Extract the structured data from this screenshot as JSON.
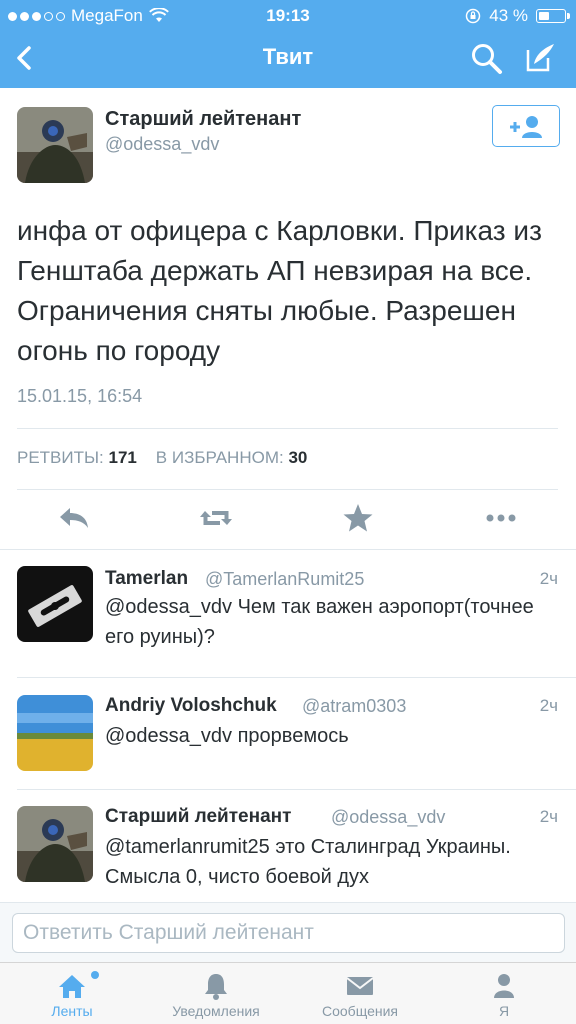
{
  "status_bar": {
    "carrier": "MegaFon",
    "time": "19:13",
    "battery": "43 %",
    "battery_level": 0.43
  },
  "nav": {
    "title": "Твит",
    "back_icon": "chevron-left-icon",
    "search_icon": "search-icon",
    "compose_icon": "compose-icon"
  },
  "tweet": {
    "author_name": "Старший лейтенант",
    "author_handle": "@odessa_vdv",
    "follow_icon": "add-user-icon",
    "text": "инфа от офицера с Карловки. Приказ из Генштаба держать АП невзирая на все. Ограничения сняты любые. Разрешен огонь по городу",
    "date": "15.01.15, 16:54",
    "retweets_label": "РЕТВИТЫ:",
    "retweets_count": "171",
    "favorites_label": "В ИЗБРАННОМ:",
    "favorites_count": "30",
    "actions": [
      "reply-icon",
      "retweet-icon",
      "star-icon",
      "more-icon"
    ]
  },
  "replies": [
    {
      "name": "Tamerlan",
      "handle": "@TamerlanRumit25",
      "time": "2ч",
      "text": "@odessa_vdv Чем так важен аэропорт(точнее его руины)?"
    },
    {
      "name": "Andriy Voloshchuk",
      "handle": "@atram0303",
      "time": "2ч",
      "text": "@odessa_vdv прорвемось"
    },
    {
      "name": "Старший лейтенант",
      "handle": "@odessa_vdv",
      "time": "2ч",
      "text": "@tamerlanrumit25 это Сталинград Украины. Смысла 0, чисто боевой дух"
    }
  ],
  "reply_box": {
    "placeholder": "Ответить Старший лейтенант"
  },
  "tabbar": {
    "tabs": [
      {
        "label": "Ленты",
        "icon": "home-icon",
        "active": true
      },
      {
        "label": "Уведомления",
        "icon": "bell-icon",
        "active": false
      },
      {
        "label": "Сообщения",
        "icon": "envelope-icon",
        "active": false
      },
      {
        "label": "Я",
        "icon": "person-icon",
        "active": false
      }
    ]
  },
  "colors": {
    "accent": "#55acee",
    "text": "#292f33",
    "muted": "#8899a6"
  }
}
